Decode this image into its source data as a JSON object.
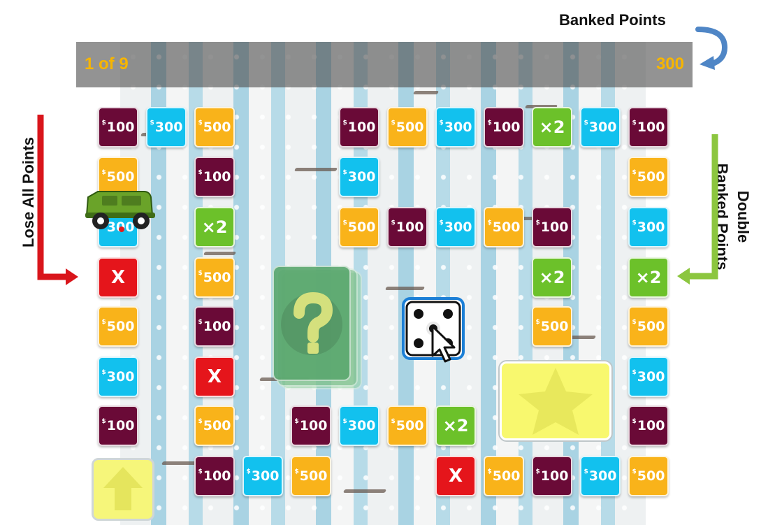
{
  "header": {
    "round": "1 of 9",
    "score": "300"
  },
  "annotations": {
    "banked_points": "Banked Points",
    "lose_all_points": "Lose All Points",
    "double_banked_points_line1": "Double",
    "double_banked_points_line2": "Banked Points"
  },
  "tile_currency": "$",
  "tiles": {
    "t100": "100",
    "t300": "300",
    "t500": "500",
    "tx2": "×2",
    "tX": "X"
  },
  "colors": {
    "maroon_tile": "#6a0a37",
    "cyan_tile": "#12c1ee",
    "orange_tile": "#f9b31a",
    "green_tile": "#6cc12a",
    "red_tile": "#e5151b",
    "score_text": "#f7b500",
    "lose_arrow": "#d9151b",
    "double_arrow": "#8cc63f",
    "banked_arrow": "#4f86c6"
  },
  "icons": {
    "player_token": "green-jeep-icon",
    "dice": "dice-four-icon",
    "cursor": "pointer-cursor-icon",
    "mystery_card": "question-card-icon",
    "start": "up-arrow-icon",
    "finish": "star-icon"
  }
}
